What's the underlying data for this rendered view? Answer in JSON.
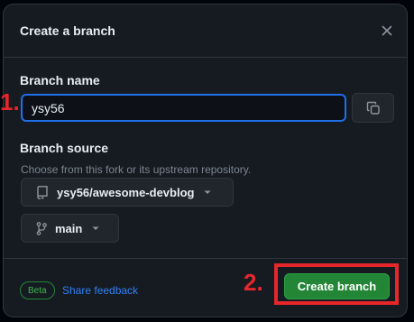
{
  "dialog": {
    "title": "Create a branch"
  },
  "branch_name": {
    "label": "Branch name",
    "value": "ysy56"
  },
  "branch_source": {
    "label": "Branch source",
    "hint": "Choose from this fork or its upstream repository.",
    "repository": "ysy56/awesome-devblog",
    "branch": "main"
  },
  "footer": {
    "badge": "Beta",
    "feedback_link": "Share feedback",
    "create_button": "Create branch"
  },
  "annotations": {
    "step1": "1.",
    "step2": "2.",
    "color": "#e5262a"
  },
  "icons": {
    "close": "close-icon",
    "copy": "copy-icon",
    "repo": "repo-icon",
    "branch": "git-branch-icon",
    "caret": "triangle-down-icon"
  },
  "colors": {
    "accent_blue": "#1f6feb",
    "primary_green": "#238636",
    "background": "#161b22"
  }
}
